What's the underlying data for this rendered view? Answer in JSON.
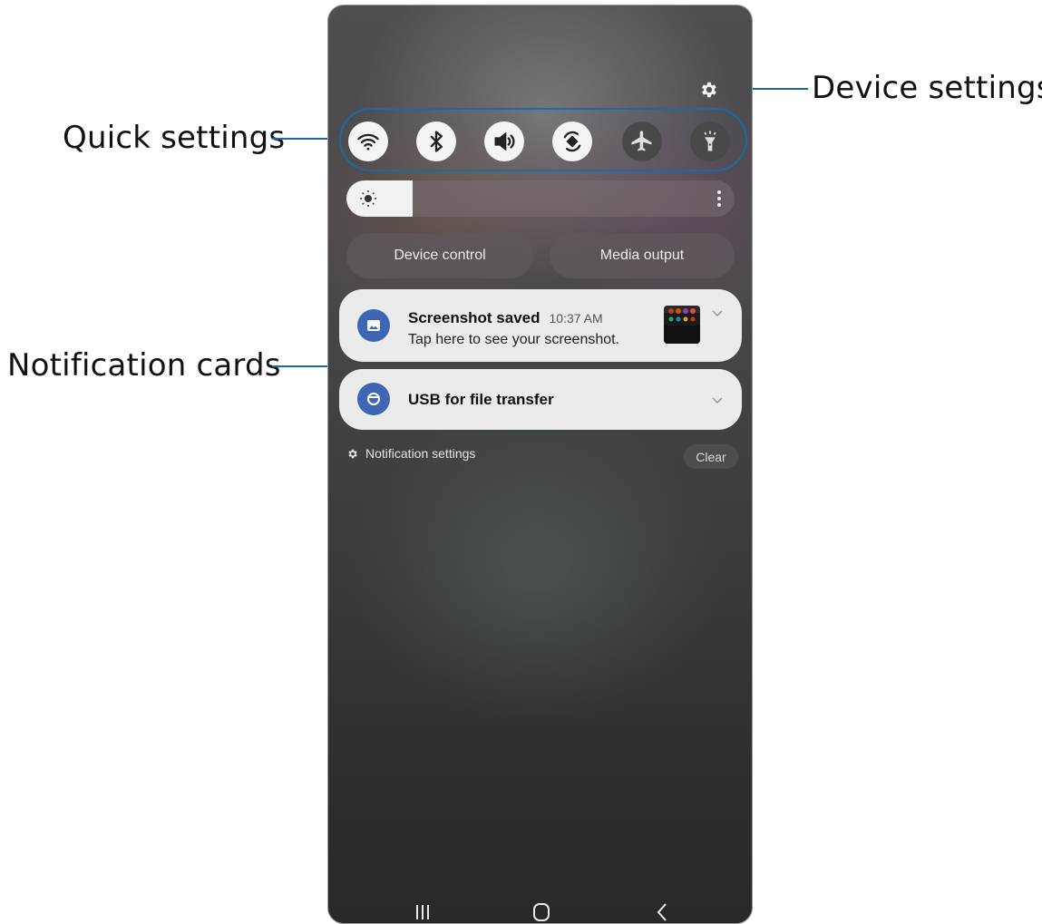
{
  "callouts": {
    "device_settings": "Device settings",
    "quick_settings": "Quick settings",
    "notification_cards": "Notification cards"
  },
  "quick_settings": {
    "buttons": [
      {
        "icon": "wifi-icon",
        "state": "on"
      },
      {
        "icon": "bluetooth-icon",
        "state": "on"
      },
      {
        "icon": "sound-icon",
        "state": "on"
      },
      {
        "icon": "auto-rotate-icon",
        "state": "on"
      },
      {
        "icon": "airplane-mode-icon",
        "state": "off"
      },
      {
        "icon": "flashlight-icon",
        "state": "off"
      }
    ],
    "brightness_level": 0.17
  },
  "actions": {
    "device_control": "Device control",
    "media_output": "Media output"
  },
  "notifications": [
    {
      "title": "Screenshot saved",
      "time": "10:37 AM",
      "body": "Tap here to see your screenshot."
    },
    {
      "title": "USB for file transfer"
    }
  ],
  "footer": {
    "notification_settings": "Notification settings",
    "clear": "Clear"
  },
  "colors": {
    "callout_line": "#1b6aa5",
    "app_icon": "#3e66b3",
    "card_bg": "#ebebeb"
  }
}
